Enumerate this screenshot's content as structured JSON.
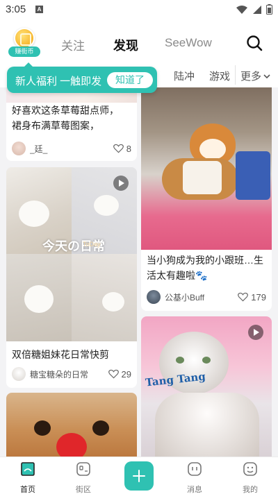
{
  "status_bar": {
    "time": "3:05",
    "notification_icon": "A"
  },
  "header": {
    "coin_label": "赚街币",
    "tabs": [
      {
        "label": "关注",
        "active": false
      },
      {
        "label": "发现",
        "active": true
      },
      {
        "label": "SeeWow",
        "active": false
      }
    ]
  },
  "categories": {
    "items": [
      "陆冲",
      "游戏"
    ],
    "more_label": "更多"
  },
  "tooltip": {
    "text": "新人福利 一触即发",
    "button": "知道了"
  },
  "feed": {
    "left": [
      {
        "title": "好喜欢这条草莓甜点师，裙身布满草莓图案，",
        "title_lines": [
          "好喜欢这条草莓甜点师，",
          "裙身布满草莓图案，"
        ],
        "author": "_廷_",
        "likes": "8"
      },
      {
        "title": "双倍糖姐妹花日常快剪",
        "author": "糖宝糖朵的日常",
        "likes": "29",
        "overlay_text": "今天の日常",
        "overlay_small": "ToDay"
      },
      {
        "title": "",
        "author": "",
        "likes": ""
      }
    ],
    "right": [
      {
        "title": "当小狗成为我的小跟班…生活太有趣啦🐾",
        "title_lines": [
          "当小狗成为我的小跟班…生",
          "活太有趣啦🐾"
        ],
        "author": "公基小Buff",
        "likes": "179"
      },
      {
        "title": "",
        "author": "",
        "likes": "",
        "overlay_text": "Tang Tang"
      }
    ]
  },
  "bottom_nav": [
    {
      "label": "首页",
      "active": true
    },
    {
      "label": "街区",
      "active": false
    },
    {
      "label": "",
      "active": false
    },
    {
      "label": "消息",
      "active": false
    },
    {
      "label": "我的",
      "active": false
    }
  ],
  "colors": {
    "accent": "#2fc1b2",
    "background": "#f3f3f5"
  }
}
